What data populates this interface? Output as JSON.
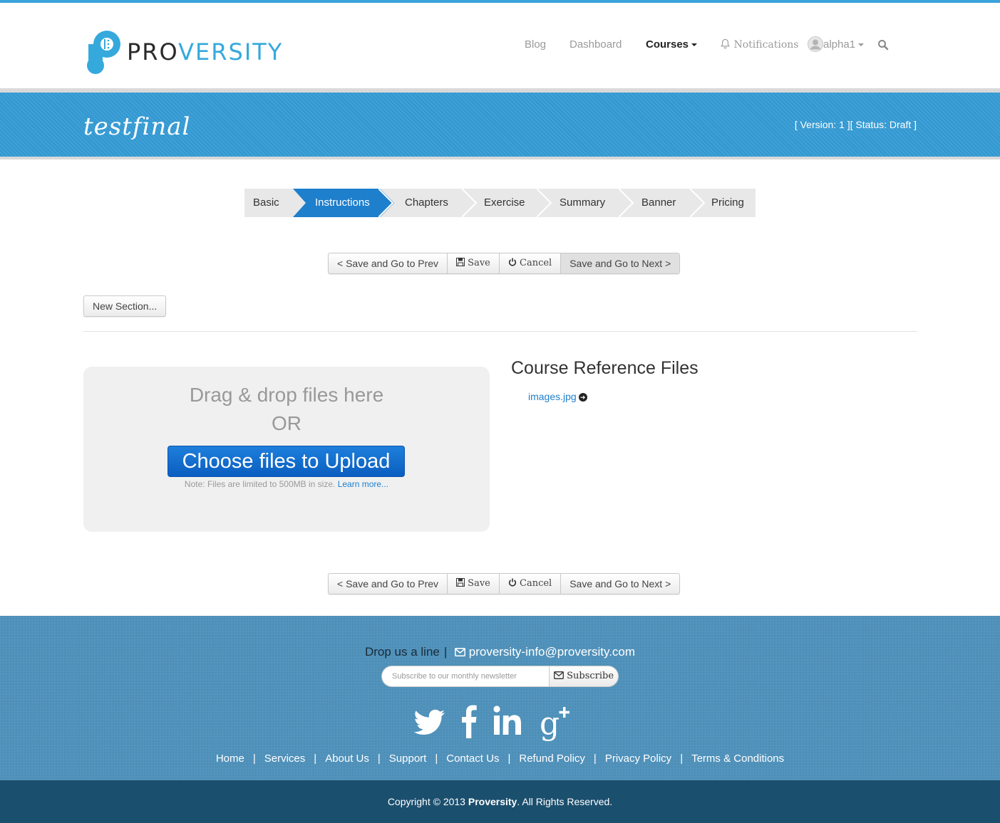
{
  "brand": {
    "pro": "PRO",
    "versity": "VERSITY"
  },
  "nav": {
    "blog": "Blog",
    "dashboard": "Dashboard",
    "courses": "Courses",
    "notifications": "Notifications",
    "user": "alpha1"
  },
  "course": {
    "title": "testfinal",
    "status": "[ Version: 1 ][ Status: Draft ]"
  },
  "steps": [
    "Basic",
    "Instructions",
    "Chapters",
    "Exercise",
    "Summary",
    "Banner",
    "Pricing"
  ],
  "active_step": "Instructions",
  "actions": {
    "prev": "< Save and Go to Prev",
    "save": "Save",
    "cancel": "Cancel",
    "next": "Save and Go to Next >"
  },
  "new_section": "New Section...",
  "upload": {
    "drag": "Drag & drop files here",
    "or": "OR",
    "choose": "Choose files to Upload",
    "note": "Note: Files are limited to 500MB in size.",
    "learn_more": "Learn more..."
  },
  "reference": {
    "title": "Course Reference Files",
    "files": [
      "images.jpg"
    ]
  },
  "footer": {
    "drop_line": "Drop us a line",
    "email": "proversity-info@proversity.com",
    "newsletter_placeholder": "Subscribe to our monthly newsletter",
    "subscribe": "Subscribe",
    "links": [
      "Home",
      "Services",
      "About Us",
      "Support",
      "Contact Us",
      "Refund Policy",
      "Privacy Policy",
      "Terms & Conditions"
    ],
    "copyright_pre": "Copyright © 2013 ",
    "copyright_brand": "Proversity",
    "copyright_post": ". All Rights Reserved."
  },
  "colors": {
    "accent": "#3399d2",
    "active_step": "#1e7fcc",
    "upload_button": "#1e7fdb",
    "footer": "#4b8eb8",
    "footer_bottom": "#1b4f6e"
  }
}
